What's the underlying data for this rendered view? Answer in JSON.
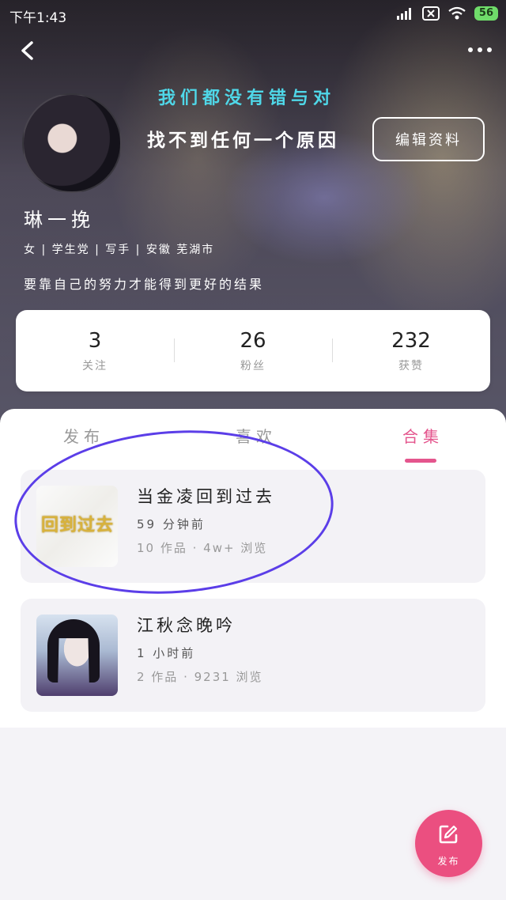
{
  "status_bar": {
    "time": "下午1:43",
    "battery": "56",
    "icons": [
      "signal-icon",
      "sim-off-icon",
      "wifi-icon",
      "battery-icon"
    ]
  },
  "header": {
    "back_icon": "back-chevron-icon",
    "more_icon": "more-dots-icon"
  },
  "profile": {
    "slogan_line1": "我们都没有错与对",
    "slogan_line2": "找不到任何一个原因",
    "edit_button": "编辑资料",
    "name": "琳一挽",
    "meta": "女 | 学生党 | 写手 | 安徽 芜湖市",
    "bio": "要靠自己的努力才能得到更好的结果"
  },
  "stats": [
    {
      "value": "3",
      "label": "关注"
    },
    {
      "value": "26",
      "label": "粉丝"
    },
    {
      "value": "232",
      "label": "获赞"
    }
  ],
  "tabs": [
    {
      "label": "发布",
      "active": false
    },
    {
      "label": "喜欢",
      "active": false
    },
    {
      "label": "合集",
      "active": true
    }
  ],
  "collections": [
    {
      "title": "当金凌回到过去",
      "time": "59 分钟前",
      "info": "10 作品 · 4w+ 浏览",
      "cover_text": "回到过去"
    },
    {
      "title": "江秋念晚吟",
      "time": "1 小时前",
      "info": "2 作品 · 9231 浏览"
    }
  ],
  "fab": {
    "label": "发布",
    "icon": "edit-square-icon"
  },
  "colors": {
    "accent": "#e4558d",
    "fab": "#eb4f80",
    "slogan": "#4fd7e8",
    "annotation_circle": "#5b3ee8"
  }
}
